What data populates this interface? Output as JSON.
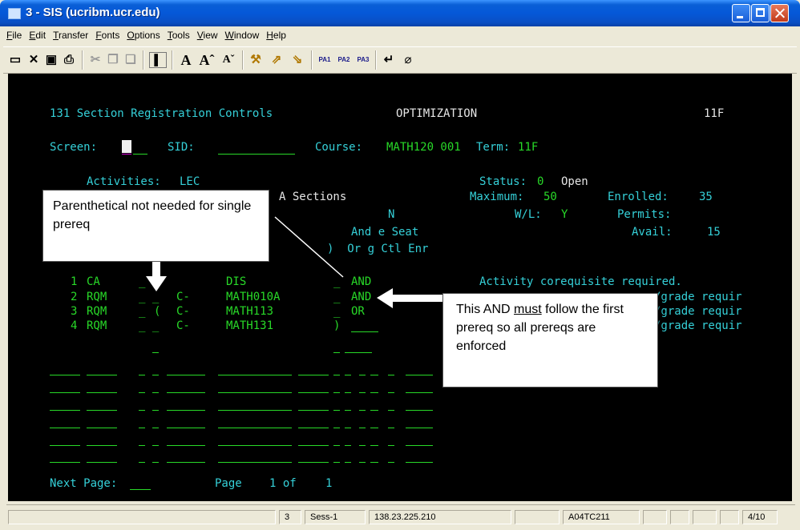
{
  "window": {
    "title": "3 - SIS (ucribm.ucr.edu)"
  },
  "menu": [
    "File",
    "Edit",
    "Transfer",
    "Fonts",
    "Options",
    "Tools",
    "View",
    "Window",
    "Help"
  ],
  "toolbar": {
    "pa1": "PA1",
    "pa2": "PA2",
    "pa3": "PA3"
  },
  "terminal": {
    "screen_title": "131 Section Registration Controls",
    "mode": "OPTIMIZATION",
    "term_code_top": "11F",
    "screen_label": "Screen:",
    "sid_label": "SID:",
    "course_label": "Course:",
    "course_value": "MATH120 001",
    "term_label": "Term:",
    "term_value": "11F",
    "activities_label": "Activities:",
    "activities_value": "LEC",
    "a_sections": "A Sections",
    "status_label": "Status:",
    "status_code": "0",
    "status_text": "Open",
    "maximum_label": "Maximum:",
    "maximum_value": "50",
    "enrolled_label": "Enrolled:",
    "enrolled_value": "35",
    "n_header": "N",
    "wl_label": "W/L:",
    "wl_value": "Y",
    "permits_label": "Permits:",
    "and_e_seat": "And e Seat",
    "avail_label": "Avail:",
    "avail_value": "15",
    "or_g_ctl_enr": ")  Or g Ctl Enr",
    "rows": [
      {
        "num": "1",
        "type": "CA",
        "paren": "",
        "grade": "",
        "course": "DIS",
        "close": "_",
        "conj": "AND",
        "desc": "Activity corequisite required."
      },
      {
        "num": "2",
        "type": "RQM",
        "paren": "_",
        "grade": "C-",
        "course": "MATH010A",
        "close": "_",
        "conj": "AND",
        "desc": "/grade requir"
      },
      {
        "num": "3",
        "type": "RQM",
        "paren": "(",
        "grade": "C-",
        "course": "MATH113",
        "close": "_",
        "conj": "OR",
        "desc": "/grade requir"
      },
      {
        "num": "4",
        "type": "RQM",
        "paren": "_",
        "grade": "C-",
        "course": "MATH131",
        "close": ")",
        "conj": "",
        "desc": "/grade requir"
      }
    ],
    "next_page_label": "Next Page:",
    "page_label": "Page",
    "page_value": "1 of",
    "page_total": "1"
  },
  "callouts": {
    "left": "Parenthetical not needed for single prereq",
    "right_pre": "This AND ",
    "right_emph": "must",
    "right_post": " follow the first prereq so all prereqs are enforced"
  },
  "statusbar": {
    "sess_num": "3",
    "session": "Sess-1",
    "host_ip": "138.23.225.210",
    "lu_name": "A04TC211",
    "cursor_pos": "4/10"
  },
  "colors": {
    "terminal_bg": "#000000",
    "field_green": "#28d928",
    "label_cyan": "#35d0d8",
    "titlebar_blue": "#0558d8"
  }
}
